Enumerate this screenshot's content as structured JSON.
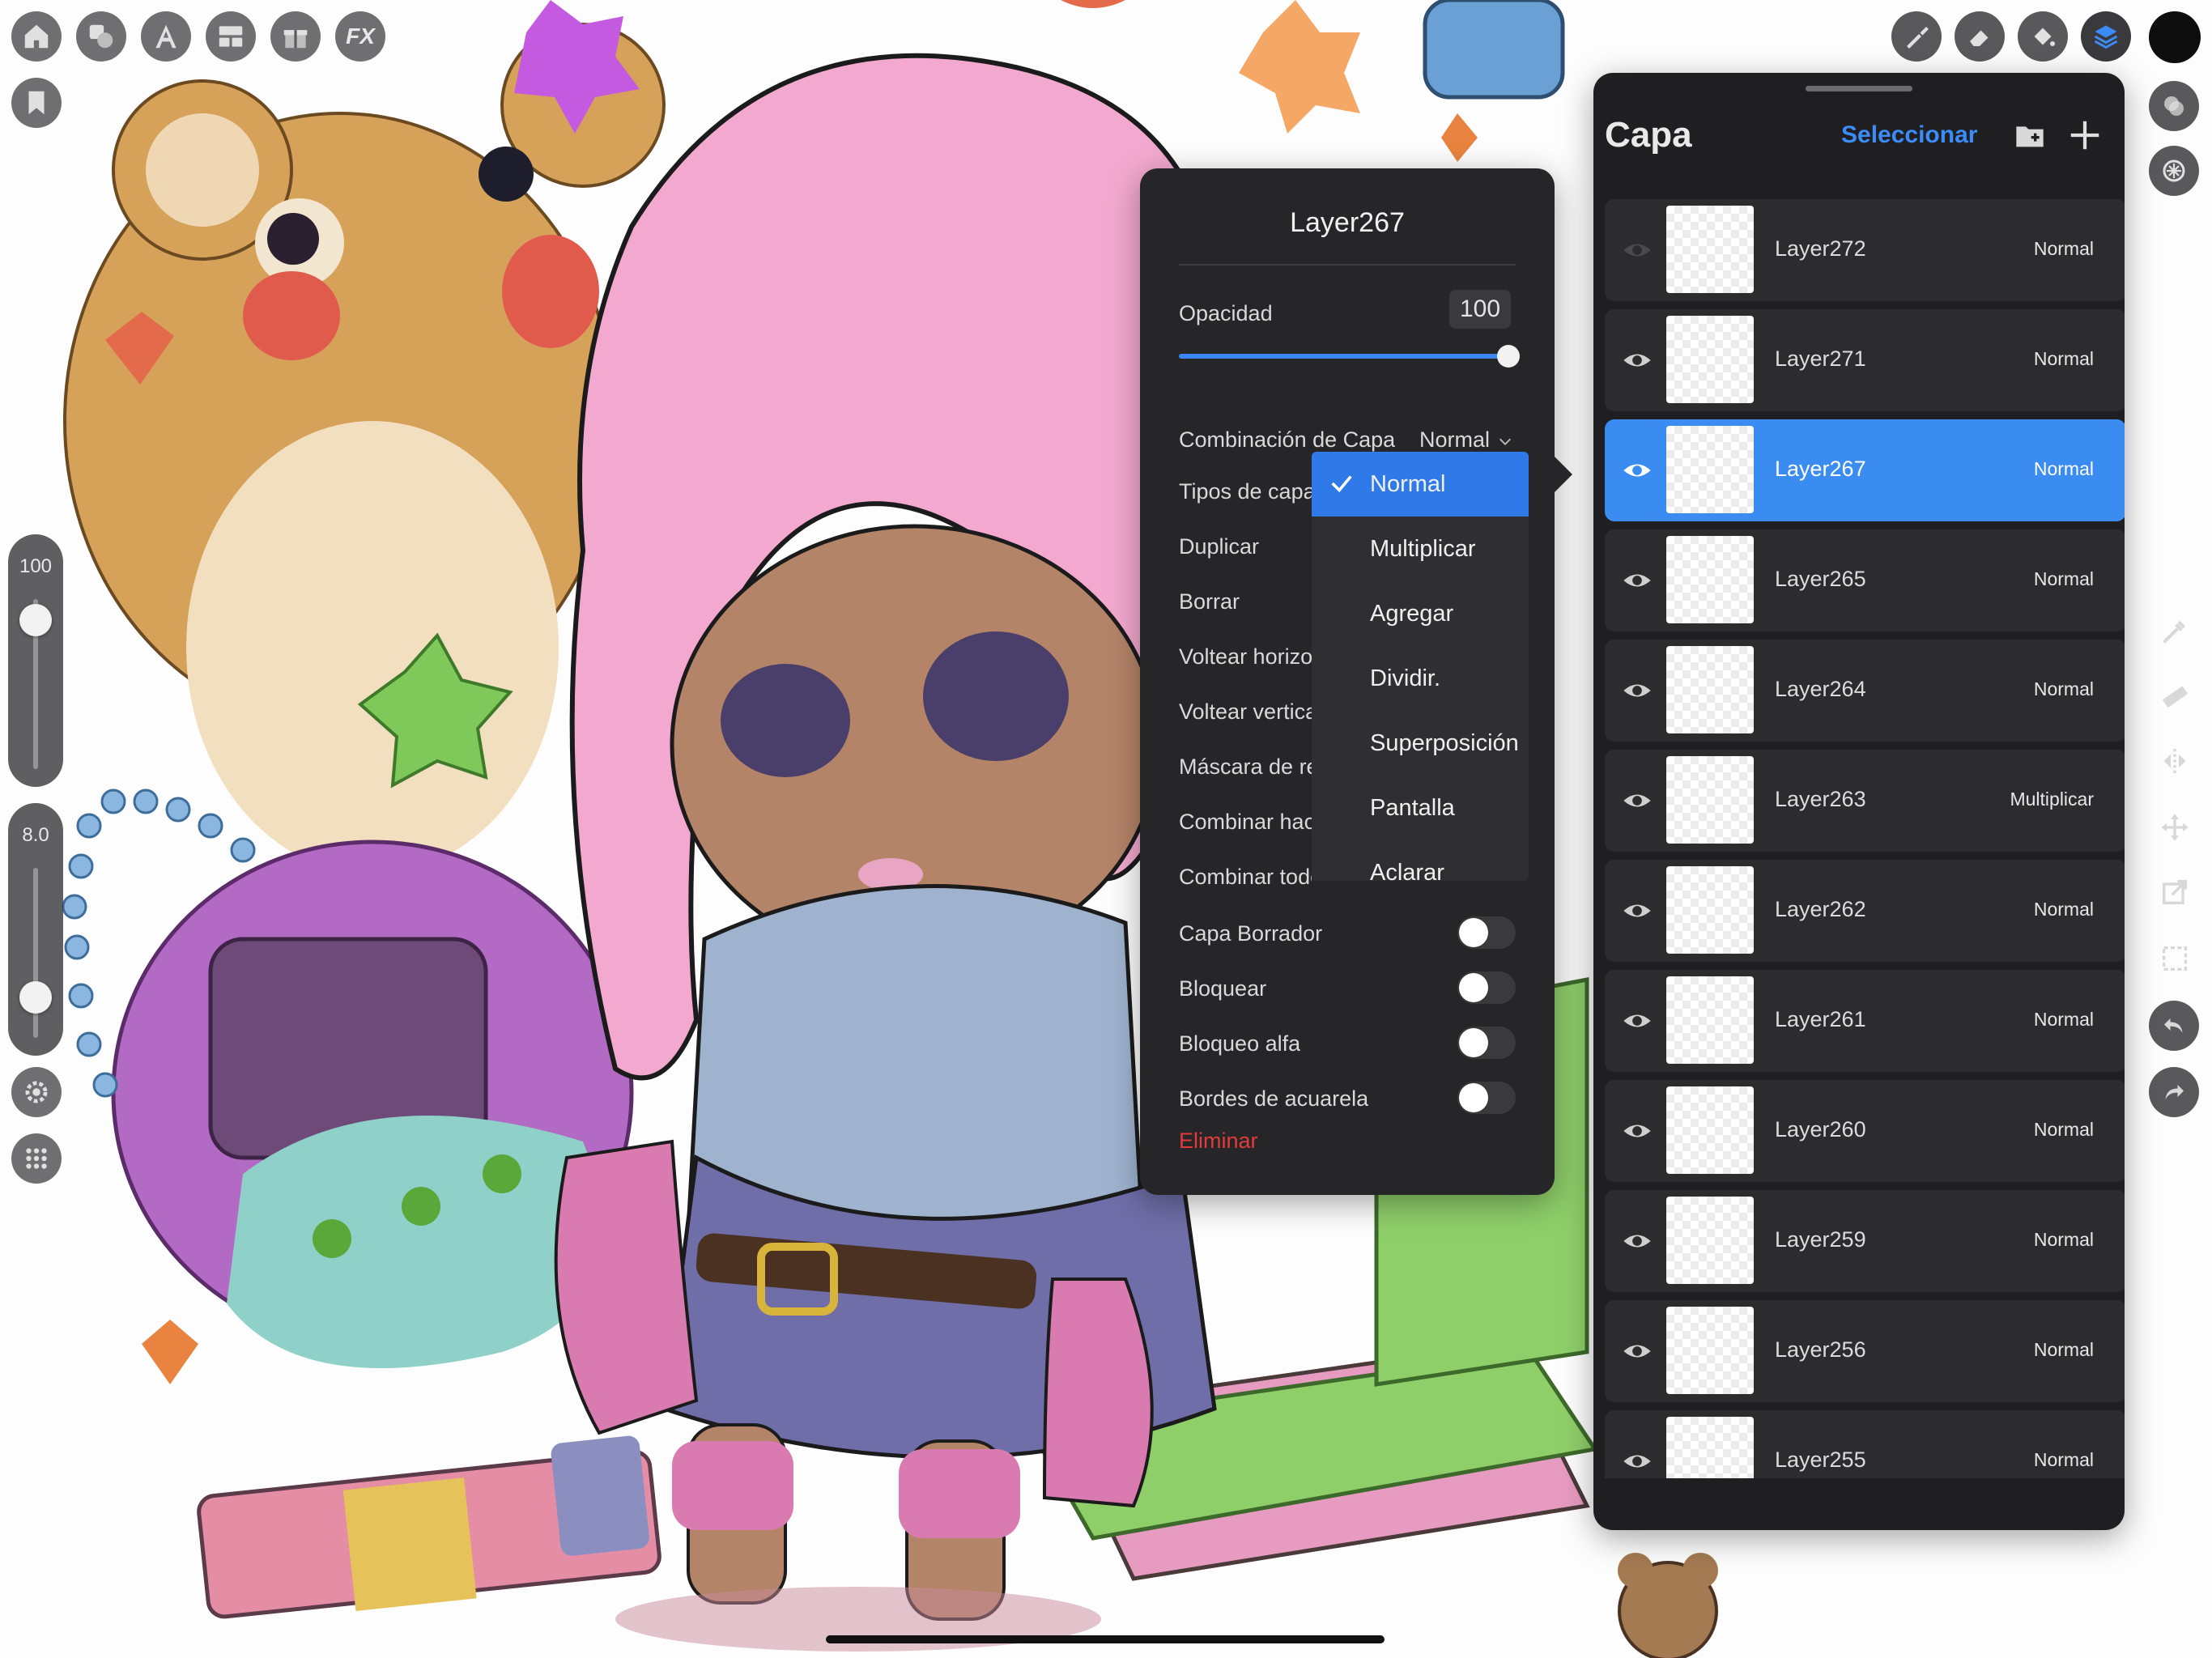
{
  "toolbar_left": {
    "fx_label": "FX",
    "icons": [
      "home-icon",
      "shapes-icon",
      "text-icon",
      "layout-icon",
      "gift-icon",
      "fx-icon",
      "bookmark-icon"
    ]
  },
  "brush_size_slider": {
    "value": "100",
    "level": 1.0
  },
  "opacity_slider": {
    "value": "8.0",
    "level": 0.08
  },
  "layer_options": {
    "title": "Layer267",
    "opacity_label": "Opacidad",
    "opacity_value": "100",
    "opacity_level": 1.0,
    "blend_label": "Combinación de Capa",
    "blend_value": "Normal",
    "rows": [
      {
        "label": "Tipos de capa"
      },
      {
        "label": "Duplicar"
      },
      {
        "label": "Borrar"
      },
      {
        "label": "Voltear horizo"
      },
      {
        "label": "Voltear vertica"
      },
      {
        "label": "Máscara de re"
      },
      {
        "label": "Combinar hac"
      },
      {
        "label": "Combinar todo"
      }
    ],
    "toggles": [
      {
        "label": "Capa Borrador",
        "on": false
      },
      {
        "label": "Bloquear",
        "on": false
      },
      {
        "label": "Bloqueo alfa",
        "on": false
      },
      {
        "label": "Bordes de acuarela",
        "on": false
      }
    ],
    "delete_label": "Eliminar"
  },
  "blend_dropdown": {
    "selected": "Normal",
    "options": [
      "Normal",
      "Multiplicar",
      "Agregar",
      "Dividir.",
      "Superposición",
      "Pantalla",
      "Aclarar"
    ]
  },
  "layers_panel": {
    "title": "Capa",
    "select_label": "Seleccionar",
    "layers": [
      {
        "name": "Layer272",
        "blend": "Normal",
        "visible": false,
        "active": false
      },
      {
        "name": "Layer271",
        "blend": "Normal",
        "visible": true,
        "active": false
      },
      {
        "name": "Layer267",
        "blend": "Normal",
        "visible": true,
        "active": true
      },
      {
        "name": "Layer265",
        "blend": "Normal",
        "visible": true,
        "active": false
      },
      {
        "name": "Layer264",
        "blend": "Normal",
        "visible": true,
        "active": false
      },
      {
        "name": "Layer263",
        "blend": "Multiplicar",
        "visible": true,
        "active": false
      },
      {
        "name": "Layer262",
        "blend": "Normal",
        "visible": true,
        "active": false
      },
      {
        "name": "Layer261",
        "blend": "Normal",
        "visible": true,
        "active": false
      },
      {
        "name": "Layer260",
        "blend": "Normal",
        "visible": true,
        "active": false
      },
      {
        "name": "Layer259",
        "blend": "Normal",
        "visible": true,
        "active": false
      },
      {
        "name": "Layer256",
        "blend": "Normal",
        "visible": true,
        "active": false
      },
      {
        "name": "Layer255",
        "blend": "Normal",
        "visible": true,
        "active": false
      }
    ]
  },
  "toolbar_right": {
    "icons": [
      "brush-icon",
      "eraser-icon",
      "fill-icon",
      "layers-icon",
      "color-swatch",
      "blend-icon",
      "texture-icon",
      "eyedropper-icon",
      "ruler-icon",
      "symmetry-icon",
      "move-icon",
      "transform-icon",
      "selection-icon",
      "undo-icon",
      "redo-icon"
    ]
  },
  "colors": {
    "accent": "#3a8cf0",
    "panel": "#1f1f21",
    "popup": "#262628",
    "danger": "#e23b3b"
  }
}
